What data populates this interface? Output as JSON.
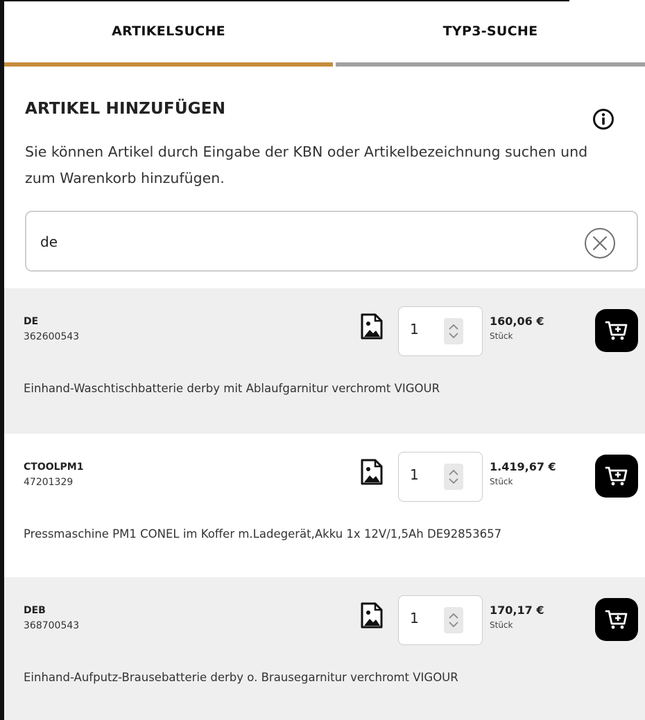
{
  "tabs": [
    {
      "label": "ARTIKELSUCHE",
      "active": true
    },
    {
      "label": "TYP3-SUCHE",
      "active": false
    }
  ],
  "colors": {
    "accent": "#c68c3c",
    "inactive_tab": "#a0a0a0",
    "row_shade": "#efefef",
    "cart_button": "#000000"
  },
  "section": {
    "title": "ARTIKEL HINZUFÜGEN",
    "description": "Sie können Artikel durch Eingabe der KBN oder Artikelbezeichnung suchen und zum Warenkorb hinzufügen.",
    "info_icon": "info-icon"
  },
  "search": {
    "value": "de",
    "clear_icon": "clear-circle-x-icon"
  },
  "results": [
    {
      "code": "DE",
      "kbn": "362600543",
      "qty": "1",
      "price": "160,06 €",
      "unit": "Stück",
      "description": "Einhand-Waschtischbatterie derby mit Ablaufgarnitur verchromt VIGOUR"
    },
    {
      "code": "CTOOLPM1",
      "kbn": "47201329",
      "qty": "1",
      "price": "1.419,67 €",
      "unit": "Stück",
      "description": "Pressmaschine PM1 CONEL im Koffer m.Ladegerät,Akku 1x 12V/1,5Ah DE92853657"
    },
    {
      "code": "DEB",
      "kbn": "368700543",
      "qty": "1",
      "price": "170,17 €",
      "unit": "Stück",
      "description": "Einhand-Aufputz-Brausebatterie derby o. Brausegarnitur verchromt VIGOUR"
    }
  ]
}
